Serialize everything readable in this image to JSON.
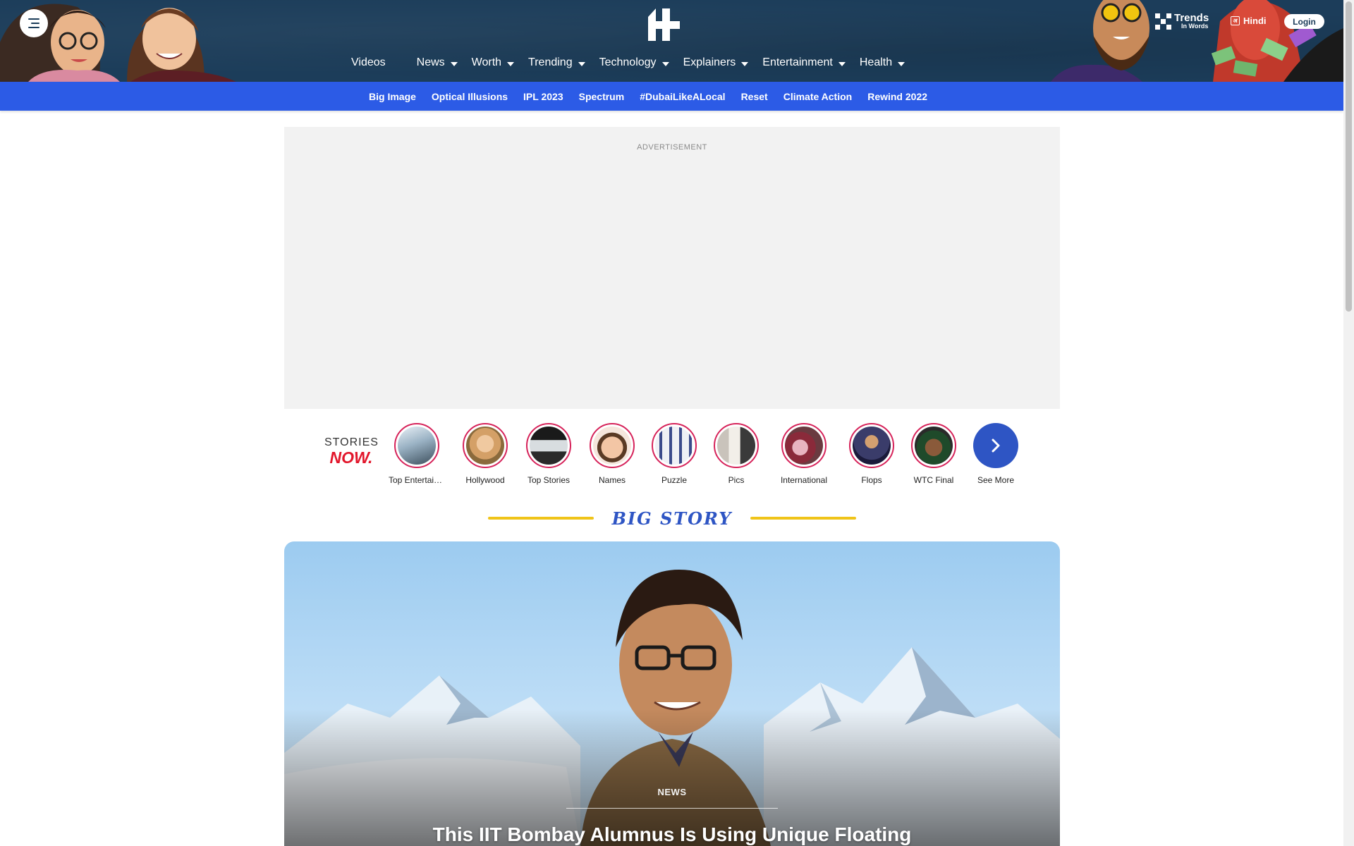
{
  "header": {
    "menu_icon": "hamburger-icon",
    "logo_icon": "indiatimes-logo-icon",
    "nav": [
      {
        "label": "Videos",
        "has_dropdown": false
      },
      {
        "label": "News",
        "has_dropdown": true
      },
      {
        "label": "Worth",
        "has_dropdown": true
      },
      {
        "label": "Trending",
        "has_dropdown": true
      },
      {
        "label": "Technology",
        "has_dropdown": true
      },
      {
        "label": "Explainers",
        "has_dropdown": true
      },
      {
        "label": "Entertainment",
        "has_dropdown": true
      },
      {
        "label": "Health",
        "has_dropdown": true
      }
    ],
    "trends": {
      "title": "Trends",
      "subtitle": "In Words"
    },
    "hindi_label": "Hindi",
    "login_label": "Login"
  },
  "sub_nav": [
    "Big Image",
    "Optical Illusions",
    "IPL 2023",
    "Spectrum",
    "#DubaiLikeALocal",
    "Reset",
    "Climate Action",
    "Rewind 2022"
  ],
  "ad": {
    "label": "ADVERTISEMENT"
  },
  "stories": {
    "brand_top": "STORIES",
    "brand_bottom": "NOW.",
    "items": [
      {
        "label": "Top Entertainment"
      },
      {
        "label": "Hollywood"
      },
      {
        "label": "Top Stories"
      },
      {
        "label": "Names"
      },
      {
        "label": "Puzzle"
      },
      {
        "label": "Pics"
      },
      {
        "label": "International"
      },
      {
        "label": "Flops"
      },
      {
        "label": "WTC Final"
      }
    ],
    "see_more": "See More"
  },
  "big_story": {
    "heading": "BIG STORY",
    "category": "NEWS",
    "title": "This IIT Bombay Alumnus Is Using Unique Floating"
  },
  "colors": {
    "header_bg": "#1c3d5a",
    "subnav_bg": "#2c5be6",
    "accent_blue": "#2e55c4",
    "accent_yellow": "#f0c419",
    "stories_red": "#e2162b"
  }
}
